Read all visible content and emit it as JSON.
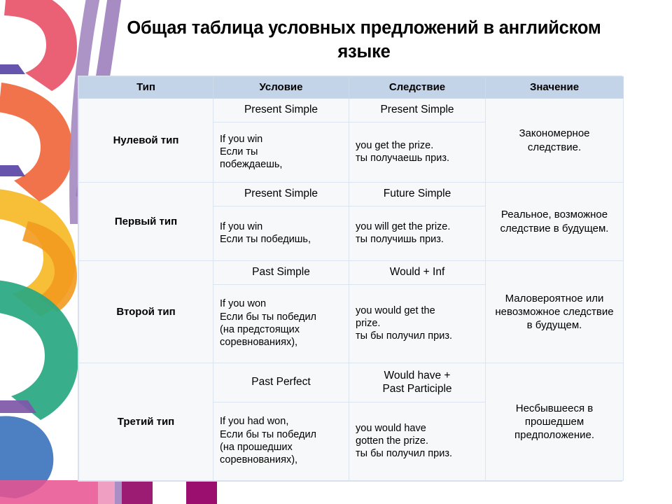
{
  "slide": {
    "title": "Общая таблица условных предложений в английском языке"
  },
  "table": {
    "headers": [
      "Тип",
      "Условие",
      "Следствие",
      "Значение"
    ],
    "rows": [
      {
        "type": "Нулевой тип",
        "condition_tense": "Present Simple",
        "condition_tense_suffix": "",
        "condition_example": "If you win\nЕсли ты\nпобеждаешь,",
        "result_tense": "Present Simple",
        "result_tense_suffix": "",
        "result_example": "you get the prize.\nты получаешь приз.",
        "meaning": "Закономерное следствие."
      },
      {
        "type": "Первый тип",
        "condition_tense": "Present Simple",
        "condition_tense_suffix": "",
        "condition_example": "If you win\nЕсли ты победишь,",
        "result_tense": "Future Simple",
        "result_tense_suffix": "",
        "result_example": "you will get the prize.\nты получишь приз.",
        "meaning": "Реальное, возможное следствие в будущем."
      },
      {
        "type": "Второй тип",
        "condition_tense": "Past Simple",
        "condition_tense_suffix": "",
        "condition_example": "If you won\nЕсли бы ты победил\n(на предстоящих\nсоревнованиях),",
        "result_tense": "Would",
        "result_tense_suffix": " + Inf",
        "result_example": "you would get the\nprize.\nты бы получил приз.",
        "meaning": "Маловероятное или невозможное следствие в будущем."
      },
      {
        "type": "Третий тип",
        "condition_tense": "Past Perfect",
        "condition_tense_suffix": "",
        "condition_example": "If you had won,\nЕсли бы ты победил\n(на прошедших\nсоревнованиях),",
        "result_tense": "Would have",
        "result_tense_suffix": " +",
        "result_tense_line2": "Past Participle",
        "result_example": "you would have\ngotten the prize.\nты бы получил приз.",
        "meaning": "Несбывшееся в прошедшем предположение."
      }
    ]
  },
  "colors": {
    "header_fill": "#c3d3e8",
    "cell_fill": "#f7f8f9",
    "tense_blue": "#2222cc",
    "grid_line": "#dce5ef",
    "deco_red": "#e8546a",
    "deco_orange": "#f0673c",
    "deco_yellow": "#f7bb2a",
    "deco_green": "#2aa881",
    "deco_blue": "#3f76bd",
    "deco_purple": "#7e57a8",
    "deco_magenta": "#a01070",
    "deco_pink": "#e8528f"
  },
  "decoration": {
    "left_art_name": "watercolor-arcs-artwork",
    "bottom_art_name": "magenta-bars-artwork"
  }
}
